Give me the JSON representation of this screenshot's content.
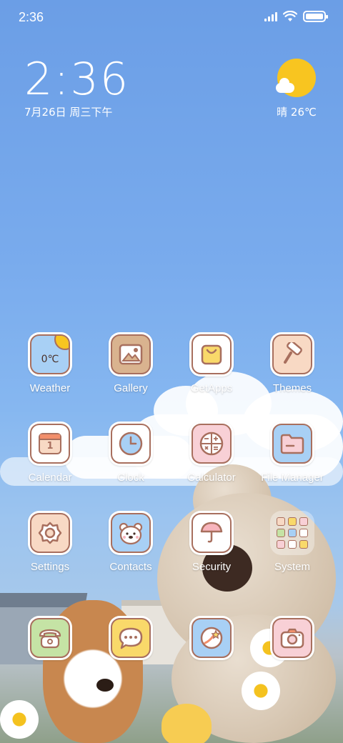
{
  "status_bar": {
    "time": "2:36",
    "battery_level": 1.0
  },
  "clock_widget": {
    "time": "2:36",
    "date": "7月26日 周三下午"
  },
  "weather_widget": {
    "condition": "晴",
    "temp": "26℃",
    "icon": "sun-cloud-icon"
  },
  "apps": [
    {
      "label": "Weather",
      "icon": "weather-icon",
      "icon_text": "0℃",
      "color": "#a8d0f5"
    },
    {
      "label": "Gallery",
      "icon": "gallery-icon",
      "color": "#d9b38f"
    },
    {
      "label": "GetApps",
      "icon": "shopping-bag-icon",
      "color": "#ffffff"
    },
    {
      "label": "Themes",
      "icon": "paint-roller-icon",
      "color": "#f8d9c4"
    },
    {
      "label": "Calendar",
      "icon": "calendar-icon",
      "icon_text": "1",
      "color": "#ffffff"
    },
    {
      "label": "Clock",
      "icon": "clock-icon",
      "color": "#ffffff"
    },
    {
      "label": "Calculator",
      "icon": "calculator-icon",
      "color": "#f8d0d6"
    },
    {
      "label": "File Manager",
      "icon": "folder-icon",
      "color": "#a8d0f5"
    },
    {
      "label": "Settings",
      "icon": "gear-icon",
      "color": "#f8d9c4"
    },
    {
      "label": "Contacts",
      "icon": "bear-face-icon",
      "color": "#a8d0f5"
    },
    {
      "label": "Security",
      "icon": "shield-icon",
      "color": "#ffffff"
    },
    {
      "label": "System",
      "icon": "folder-grid-icon",
      "color": "transparent"
    }
  ],
  "dock": [
    {
      "icon": "phone-icon",
      "color": "#c5e3a5"
    },
    {
      "icon": "message-icon",
      "color": "#f9d96a"
    },
    {
      "icon": "browser-icon",
      "color": "#a8d0f5"
    },
    {
      "icon": "camera-icon",
      "color": "#f8d0d6"
    }
  ],
  "colors": {
    "icon_border": "#a86f5e",
    "sun": "#f8c520",
    "sky": "#79abed"
  }
}
